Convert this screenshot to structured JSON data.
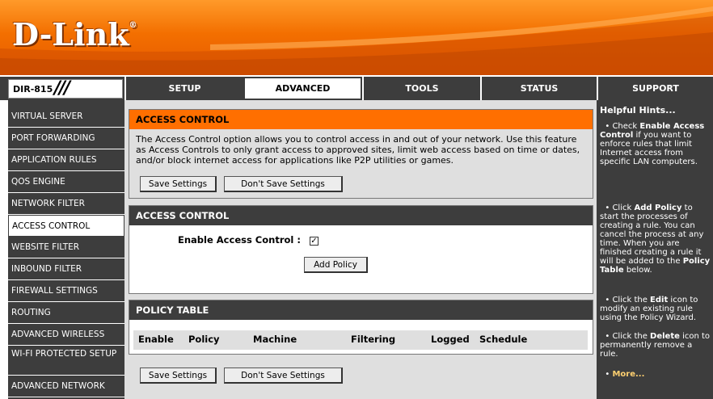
{
  "brand": {
    "logo_text": "D-Link",
    "reg_mark": "®"
  },
  "header": {
    "model": "DIR-815",
    "model_slashes": "///"
  },
  "tabs": [
    {
      "label": "SETUP"
    },
    {
      "label": "ADVANCED"
    },
    {
      "label": "TOOLS"
    },
    {
      "label": "STATUS"
    },
    {
      "label": "SUPPORT"
    }
  ],
  "sidebar": {
    "items": [
      {
        "label": "VIRTUAL SERVER"
      },
      {
        "label": "PORT FORWARDING"
      },
      {
        "label": "APPLICATION RULES"
      },
      {
        "label": "QOS ENGINE"
      },
      {
        "label": "NETWORK FILTER"
      },
      {
        "label": "ACCESS CONTROL"
      },
      {
        "label": "WEBSITE FILTER"
      },
      {
        "label": "INBOUND FILTER"
      },
      {
        "label": "FIREWALL SETTINGS"
      },
      {
        "label": "ROUTING"
      },
      {
        "label": "ADVANCED WIRELESS"
      },
      {
        "label": "WI-FI PROTECTED SETUP"
      },
      {
        "label": "ADVANCED NETWORK"
      }
    ]
  },
  "intro": {
    "title": "ACCESS CONTROL",
    "text": "The Access Control option allows you to control access in and out of your network. Use this feature as Access Controls to only grant access to approved sites, limit web access based on time or dates, and/or block internet access for applications like P2P utilities or games.",
    "save_label": "Save Settings",
    "dont_save_label": "Don't Save Settings"
  },
  "access_control": {
    "title": "ACCESS CONTROL",
    "enable_label": "Enable Access Control :",
    "enable_checked": true,
    "check_mark": "✓",
    "add_policy_label": "Add Policy"
  },
  "policy_table": {
    "title": "POLICY TABLE",
    "columns": [
      "Enable",
      "Policy",
      "Machine",
      "Filtering",
      "Logged",
      "Schedule"
    ]
  },
  "footer_buttons": {
    "save_label": "Save Settings",
    "dont_save_label": "Don't Save Settings"
  },
  "hints": {
    "title": "Helpful Hints...",
    "items": [
      {
        "pre": "Check ",
        "bold": "Enable Access Control",
        "post": " if you want to enforce rules that limit Internet access from specific LAN computers."
      },
      {
        "pre": "Click ",
        "bold": "Add Policy",
        "post": " to start the processes of creating a rule. You can cancel the process at any time. When you are finished creating a rule it will be added to the ",
        "bold2": "Policy Table",
        "post2": " below."
      },
      {
        "pre": "Click the ",
        "bold": "Edit",
        "post": " icon to modify an existing rule using the Policy Wizard."
      },
      {
        "pre": "Click the ",
        "bold": "Delete",
        "post": " icon to permanently remove a rule."
      }
    ],
    "more_label": "More..."
  },
  "colors": {
    "accent": "#ff6f00",
    "dark": "#3d3d3d",
    "panel_bg": "#dfdfdf"
  }
}
